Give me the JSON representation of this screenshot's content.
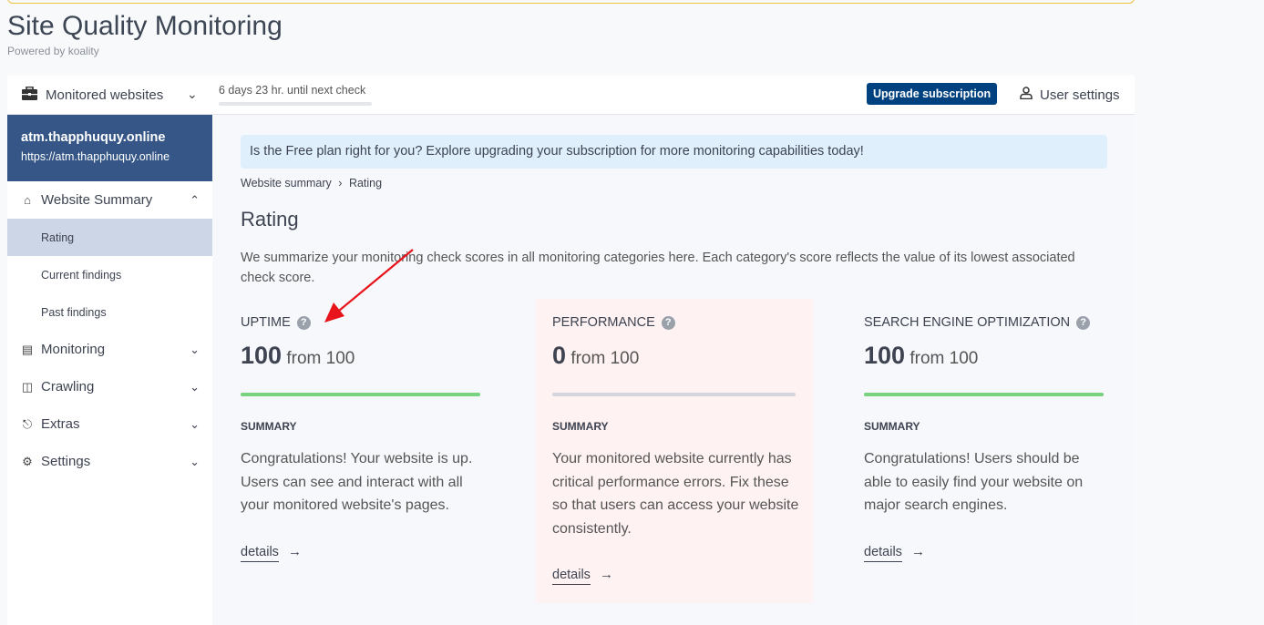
{
  "app": {
    "title": "Site Quality Monitoring",
    "powered_by": "Powered by koality"
  },
  "header": {
    "monitored_websites": "Monitored websites",
    "next_check": "6 days 23 hr. until next check",
    "upgrade": "Upgrade subscription",
    "user_settings": "User settings"
  },
  "sidebar": {
    "site_name": "atm.thapphuquy.online",
    "site_url": "https://atm.thapphuquy.online",
    "items": [
      {
        "label": "Website Summary",
        "icon": "home-icon",
        "expanded": true
      },
      {
        "label": "Monitoring",
        "icon": "chart-icon"
      },
      {
        "label": "Crawling",
        "icon": "search-document-icon"
      },
      {
        "label": "Extras",
        "icon": "plug-icon"
      },
      {
        "label": "Settings",
        "icon": "gear-icon"
      }
    ],
    "subitems": [
      {
        "label": "Rating",
        "active": true
      },
      {
        "label": "Current findings"
      },
      {
        "label": "Past findings"
      }
    ]
  },
  "main": {
    "banner": "Is the Free plan right for you? Explore upgrading your subscription for more monitoring capabilities today!",
    "breadcrumb": [
      "Website summary",
      "Rating"
    ],
    "title": "Rating",
    "description": "We summarize your monitoring check scores in all monitoring categories here. Each category's score reflects the value of its lowest associated check score.",
    "cards": [
      {
        "category": "UPTIME",
        "score": "100",
        "from": "from 100",
        "progress": 100,
        "summary_label": "SUMMARY",
        "summary": "Congratulations! Your website is up. Users can see and interact with all your monitored website's pages.",
        "details": "details"
      },
      {
        "category": "PERFORMANCE",
        "score": "0",
        "from": "from 100",
        "progress": 0,
        "summary_label": "SUMMARY",
        "summary": "Your monitored website currently has critical performance errors. Fix these so that users can access your website consistently.",
        "details": "details"
      },
      {
        "category": "SEARCH ENGINE OPTIMIZATION",
        "score": "100",
        "from": "from 100",
        "progress": 100,
        "summary_label": "SUMMARY",
        "summary": "Congratulations! Users should be able to easily find your website on major search engines.",
        "details": "details"
      }
    ]
  },
  "colors": {
    "brand": "#004280",
    "site_header": "#355687",
    "good": "#78d27e",
    "bad_bg": "#fff2f2",
    "annotation": "#e8141b"
  }
}
